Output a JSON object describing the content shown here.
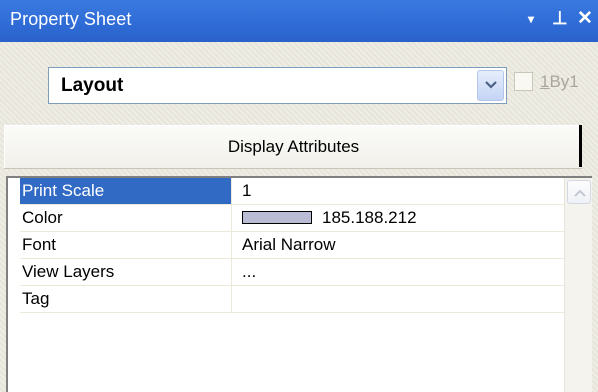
{
  "window": {
    "title": "Property Sheet"
  },
  "titlebar": {
    "menu_icon": "▾",
    "pin_icon": "⊥",
    "close_icon": "✕"
  },
  "selector": {
    "value": "Layout"
  },
  "checkbox": {
    "label_underlined": "1",
    "label_rest": "By1",
    "checked": false
  },
  "section": {
    "title": "Display Attributes"
  },
  "properties": [
    {
      "name": "Print Scale",
      "value": "1"
    },
    {
      "name": "Color",
      "value": "185.188.212",
      "swatch": "#b9bcd4"
    },
    {
      "name": "Font",
      "value": "Arial Narrow"
    },
    {
      "name": "View Layers",
      "value": "..."
    },
    {
      "name": "Tag",
      "value": ""
    }
  ],
  "colors": {
    "titlebar": "#2f6bd6",
    "selection": "#316ac5"
  }
}
